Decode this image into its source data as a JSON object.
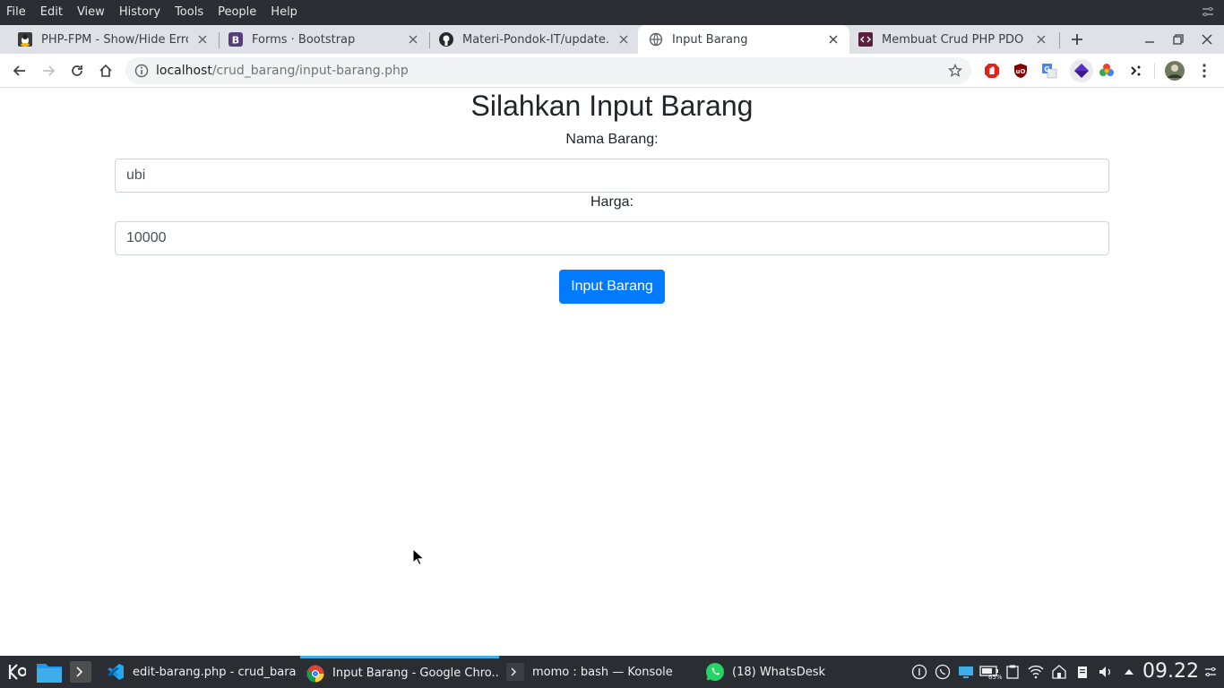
{
  "menubar": {
    "items": [
      "File",
      "Edit",
      "View",
      "History",
      "Tools",
      "People",
      "Help"
    ]
  },
  "tabs": [
    {
      "title": "PHP-FPM - Show/Hide Erro",
      "icon": "tux-icon"
    },
    {
      "title": "Forms · Bootstrap",
      "icon": "bootstrap-icon"
    },
    {
      "title": "Materi-Pondok-IT/update.p",
      "icon": "github-icon"
    },
    {
      "title": "Input Barang",
      "icon": "globe-icon",
      "active": true
    },
    {
      "title": "Membuat Crud PHP PDO -",
      "icon": "code-icon"
    }
  ],
  "address_bar": {
    "host": "localhost",
    "path": "/crud_barang/input-barang.php"
  },
  "page": {
    "title": "Silahkan Input Barang",
    "nama_label": "Nama Barang:",
    "nama_value": "ubi",
    "harga_label": "Harga:",
    "harga_value": "10000",
    "submit_label": "Input Barang"
  },
  "taskbar": {
    "tasks": [
      {
        "label": "edit-barang.php - crud_bara...",
        "icon": "vscode-icon"
      },
      {
        "label": "Input Barang - Google Chro...",
        "icon": "chrome-icon",
        "active": true
      },
      {
        "label": "momo : bash — Konsole",
        "icon": "terminal-icon"
      },
      {
        "label": "(18) WhatsDesk",
        "icon": "whatsapp-icon"
      }
    ],
    "battery_percent": "65%",
    "clock": "09.22"
  },
  "colors": {
    "primary_button": "#007bff",
    "taskbar_bg": "#2a2e32",
    "active_task_accent": "#3daee9"
  }
}
